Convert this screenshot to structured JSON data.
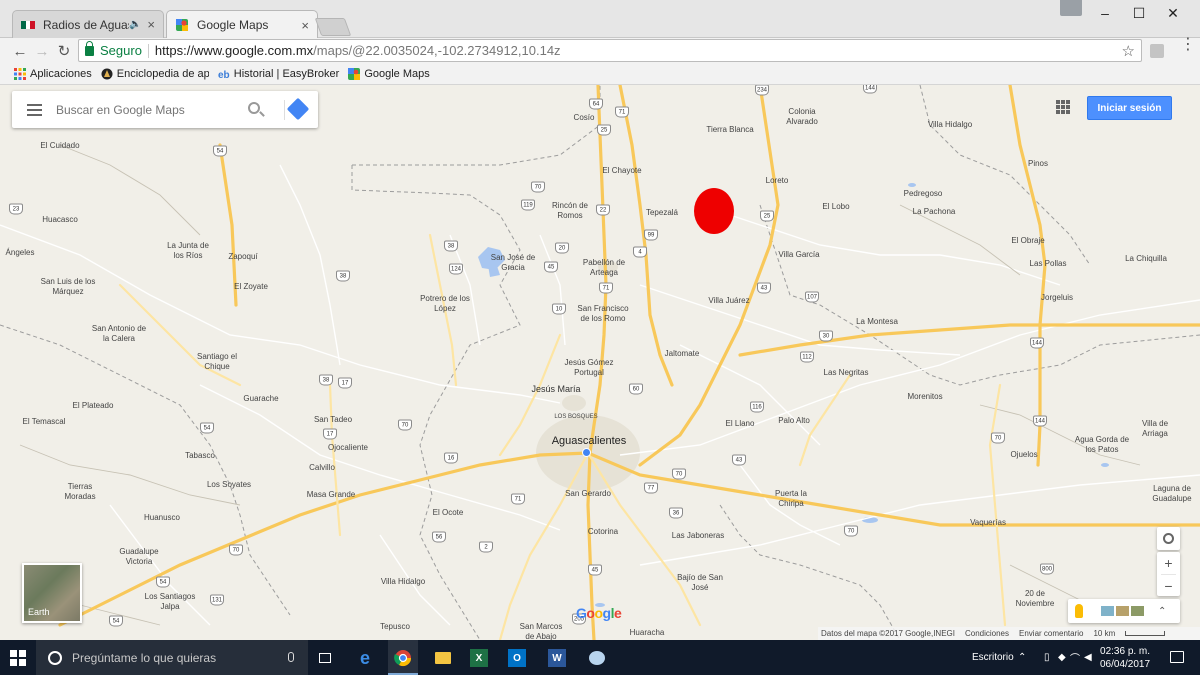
{
  "browser": {
    "tabs": [
      {
        "title": "Radios de Aguascalier",
        "audio": "🔈",
        "close": "×"
      },
      {
        "title": "Google Maps",
        "close": "×"
      }
    ],
    "window_controls": {
      "minimize": "–",
      "maximize": "☐",
      "close": "✕"
    },
    "nav": {
      "back": "←",
      "forward": "→",
      "reload": "↻"
    },
    "address": {
      "secure_label": "Seguro",
      "url_host": "https://www.google.com.mx",
      "url_path": "/maps/@22.0035024,-102.2734912,10.14z"
    },
    "star": "☆",
    "menu": "⋮",
    "bookmarks": [
      {
        "label": "Aplicaciones",
        "icon": "apps-icon"
      },
      {
        "label": "Enciclopedia de apert",
        "icon": "encyclopedia-icon"
      },
      {
        "label": "Historial | EasyBroker",
        "icon": "easybroker-icon"
      },
      {
        "label": "Google Maps",
        "icon": "google-maps-icon"
      }
    ]
  },
  "maps": {
    "search_placeholder": "Buscar en Google Maps",
    "signin_label": "Iniciar sesión",
    "zoom_in": "+",
    "zoom_out": "−",
    "layers_chevron": "⌃",
    "earth_label": "Earth",
    "google_logo": "Google",
    "attribution": {
      "data": "Datos del mapa ©2017 Google,INEGI",
      "terms": "Condiciones",
      "feedback": "Enviar comentario",
      "scale": "10 km"
    },
    "places": [
      {
        "name": "Aguascalientes",
        "size": "big"
      },
      {
        "name": "Jesús María",
        "size": "mid"
      },
      {
        "name": "LOS BOSQUES",
        "size": "small"
      },
      {
        "name": "Cosío"
      },
      {
        "name": "Colonia Alvarado"
      },
      {
        "name": "Tierra Blanca"
      },
      {
        "name": "Villa Hidalgo"
      },
      {
        "name": "El Cuidado"
      },
      {
        "name": "Pinos"
      },
      {
        "name": "El Chayote"
      },
      {
        "name": "Loreto"
      },
      {
        "name": "Pedregoso"
      },
      {
        "name": "Rincón de Romos"
      },
      {
        "name": "Tepezalá"
      },
      {
        "name": "El Lobo"
      },
      {
        "name": "La Pachona"
      },
      {
        "name": "Huacasco"
      },
      {
        "name": "El Obraje"
      },
      {
        "name": "Villa García"
      },
      {
        "name": "La Junta de los Ríos"
      },
      {
        "name": "Zapoquí"
      },
      {
        "name": "San José de Gracia"
      },
      {
        "name": "Pabellón de Arteaga"
      },
      {
        "name": "Las Pollas"
      },
      {
        "name": "La Chiquilla"
      },
      {
        "name": "San Luis de los Márquez"
      },
      {
        "name": "El Zoyate"
      },
      {
        "name": "Potrero de los López"
      },
      {
        "name": "Villa Juárez"
      },
      {
        "name": "Jorgeluis"
      },
      {
        "name": "San Francisco de los Romo"
      },
      {
        "name": "San Antonio de la Calera"
      },
      {
        "name": "La Montesa"
      },
      {
        "name": "Santiago el Chique"
      },
      {
        "name": "Jaltomate"
      },
      {
        "name": "Jesús Gómez Portugal"
      },
      {
        "name": "Las Negritas"
      },
      {
        "name": "Morenitos"
      },
      {
        "name": "Guarache"
      },
      {
        "name": "El Plateado"
      },
      {
        "name": "San Tadeo"
      },
      {
        "name": "Palo Alto"
      },
      {
        "name": "El Temascal"
      },
      {
        "name": "El Llano"
      },
      {
        "name": "Ojocaliente"
      },
      {
        "name": "Villa de Arriaga"
      },
      {
        "name": "Agua Gorda de los Patos"
      },
      {
        "name": "Tabasco"
      },
      {
        "name": "Calvillo"
      },
      {
        "name": "Ojuelos"
      },
      {
        "name": "Los Soyates"
      },
      {
        "name": "Tierras Moradas"
      },
      {
        "name": "Masa Grande"
      },
      {
        "name": "San Gerardo"
      },
      {
        "name": "Puerta la Chiripa"
      },
      {
        "name": "Laguna de Guadalupe"
      },
      {
        "name": "Huanusco"
      },
      {
        "name": "El Ocote"
      },
      {
        "name": "Vaquerías"
      },
      {
        "name": "Cotorina"
      },
      {
        "name": "Las Jaboneras"
      },
      {
        "name": "Guadalupe Victoria"
      },
      {
        "name": "Villa Hidalgo"
      },
      {
        "name": "Bajío de San José"
      },
      {
        "name": "Los Santiagos Jalpa"
      },
      {
        "name": "20 de Noviembre"
      },
      {
        "name": "Tepusco"
      },
      {
        "name": "San Marcos de Abajo"
      },
      {
        "name": "Huaracha"
      },
      {
        "name": "Ángeles"
      }
    ],
    "shields": [
      "234",
      "144",
      "64",
      "71",
      "25",
      "54",
      "70",
      "119",
      "22",
      "25",
      "23",
      "38",
      "124",
      "20",
      "4",
      "99",
      "45",
      "38",
      "71",
      "10",
      "43",
      "107",
      "30",
      "112",
      "144",
      "38",
      "17",
      "60",
      "116",
      "70",
      "43",
      "54",
      "17",
      "16",
      "70",
      "77",
      "71",
      "144",
      "70",
      "36",
      "56",
      "2",
      "70",
      "54",
      "131",
      "45",
      "800",
      "205",
      "54",
      "70"
    ]
  },
  "taskbar": {
    "search_placeholder": "Pregúntame lo que quieras",
    "desktop_label": "Escritorio",
    "time": "02:36 p. m.",
    "date": "06/04/2017"
  },
  "colors": {
    "marker": "#ee0000",
    "map_land": "#f1efe8",
    "signin_button": "#4d90fe",
    "highway": "#fdd97d",
    "taskbar": "#101a2a"
  }
}
